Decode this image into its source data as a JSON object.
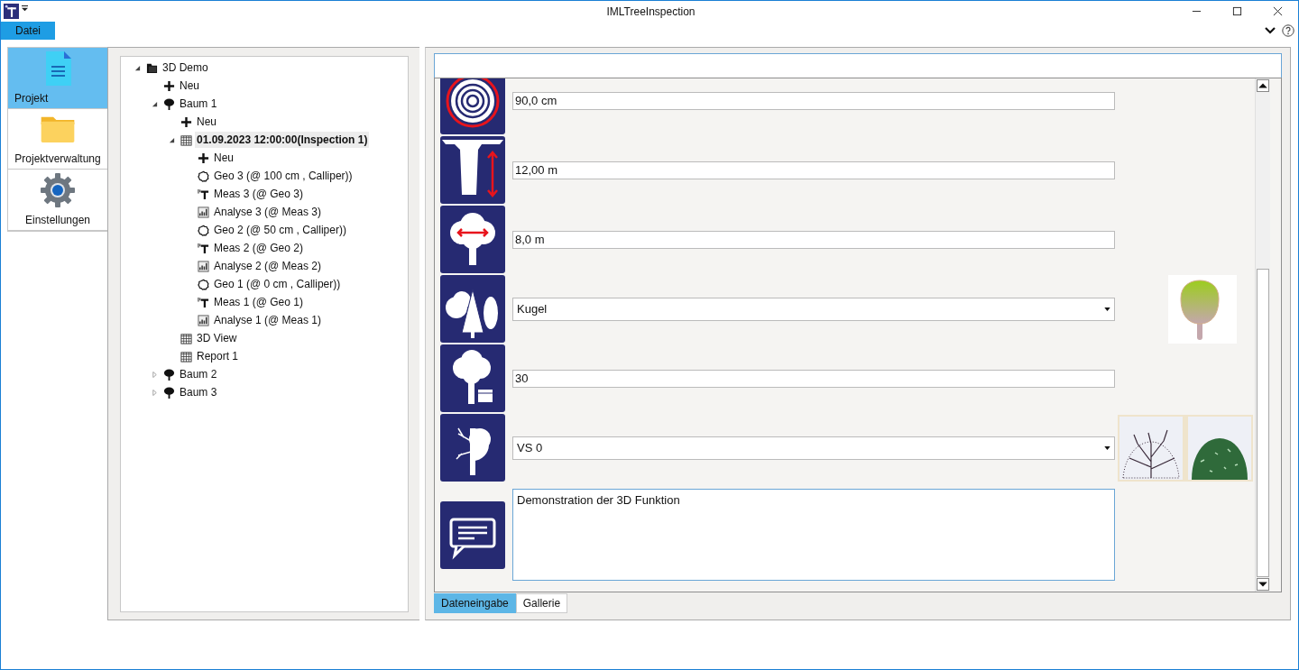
{
  "window": {
    "title": "IMLTreeInspection"
  },
  "menu": [
    {
      "label": "Datei",
      "selected": true
    }
  ],
  "nav": [
    {
      "label": "Projekt",
      "selected": true
    },
    {
      "label": "Projektverwaltung",
      "selected": false
    },
    {
      "label": "Einstellungen",
      "selected": false
    }
  ],
  "tree": [
    {
      "label": "3D Demo",
      "kind": "folder",
      "expanded": true,
      "selected": false,
      "children": [
        {
          "label": "Neu",
          "kind": "plus",
          "selected": false
        },
        {
          "label": "Baum 1",
          "kind": "tree",
          "expanded": true,
          "selected": false,
          "children": [
            {
              "label": "Neu",
              "kind": "plus",
              "selected": false
            },
            {
              "label": "01.09.2023 12:00:00(Inspection 1)",
              "kind": "calendar",
              "expanded": true,
              "selected": true,
              "children": [
                {
                  "label": "Neu",
                  "kind": "plus",
                  "selected": false
                },
                {
                  "label": "Geo 3 (@ 100 cm , Calliper))",
                  "kind": "geo",
                  "selected": false
                },
                {
                  "label": "Meas 3 (@ Geo 3)",
                  "kind": "meas",
                  "selected": false
                },
                {
                  "label": "Analyse 3 (@ Meas 3)",
                  "kind": "chart",
                  "selected": false
                },
                {
                  "label": "Geo 2 (@ 50 cm , Calliper))",
                  "kind": "geo",
                  "selected": false
                },
                {
                  "label": "Meas 2 (@ Geo 2)",
                  "kind": "meas",
                  "selected": false
                },
                {
                  "label": "Analyse 2 (@ Meas 2)",
                  "kind": "chart",
                  "selected": false
                },
                {
                  "label": "Geo 1 (@ 0 cm , Calliper))",
                  "kind": "geo",
                  "selected": false
                },
                {
                  "label": "Meas 1 (@ Geo 1)",
                  "kind": "meas",
                  "selected": false
                },
                {
                  "label": "Analyse 1 (@ Meas 1)",
                  "kind": "chart",
                  "selected": false
                }
              ]
            },
            {
              "label": "3D View",
              "kind": "calendar",
              "selected": false
            },
            {
              "label": "Report 1",
              "kind": "calendar",
              "selected": false
            }
          ]
        },
        {
          "label": "Baum 2",
          "kind": "tree",
          "expanded": false,
          "selected": false
        },
        {
          "label": "Baum 3",
          "kind": "tree",
          "expanded": false,
          "selected": false
        }
      ]
    }
  ],
  "form": [
    {
      "kind": "text",
      "value": "90,0 cm"
    },
    {
      "kind": "text",
      "value": "12,00 m"
    },
    {
      "kind": "text",
      "value": "8,0 m"
    },
    {
      "kind": "dropdown",
      "value": "Kugel"
    },
    {
      "kind": "text",
      "value": "30"
    },
    {
      "kind": "dropdown",
      "value": "VS 0"
    },
    {
      "kind": "textarea",
      "value": "Demonstration der 3D Funktion"
    }
  ],
  "tabs": [
    {
      "label": "Dateneingabe",
      "selected": true
    },
    {
      "label": "Gallerie",
      "selected": false
    }
  ]
}
